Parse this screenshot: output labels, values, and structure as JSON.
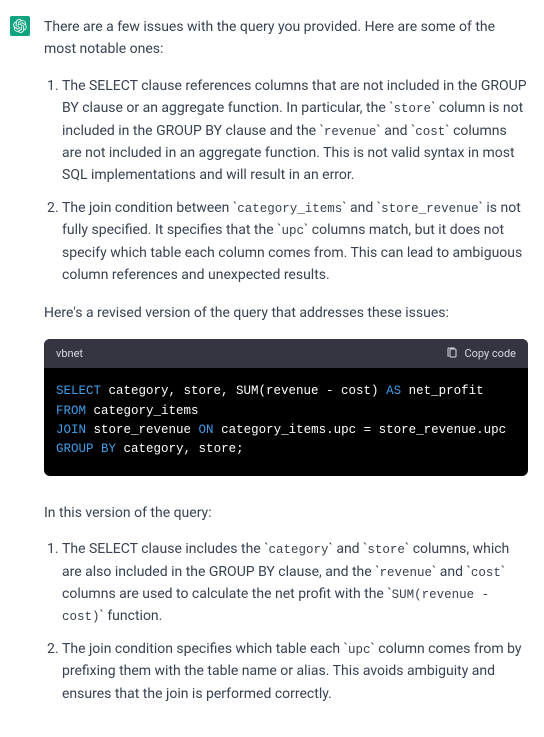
{
  "intro": "There are a few issues with the query you provided. Here are some of the most notable ones:",
  "issues": [
    {
      "seg1": "The SELECT clause references columns that are not included in the GROUP BY clause or an aggregate function. In particular, the ",
      "c1": "store",
      "seg2": " column is not included in the GROUP BY clause and the ",
      "c2": "revenue",
      "seg3": " and ",
      "c3": "cost",
      "seg4": " columns are not included in an aggregate function. This is not valid syntax in most SQL implementations and will result in an error."
    },
    {
      "seg1": "The join condition between ",
      "c1": "category_items",
      "seg2": " and ",
      "c2": "store_revenue",
      "seg3": " is not fully specified. It specifies that the ",
      "c3": "upc",
      "seg4": " columns match, but it does not specify which table each column comes from. This can lead to ambiguous column references and unexpected results."
    }
  ],
  "revised_intro": "Here's a revised version of the query that addresses these issues:",
  "code": {
    "lang": "vbnet",
    "copy_label": "Copy code",
    "l1": {
      "kw": "SELECT",
      "rest1": " category, store, SUM(revenue - cost) ",
      "as": "AS",
      "rest2": " net_profit"
    },
    "l2": {
      "kw": "FROM",
      "rest": " category_items"
    },
    "l3": {
      "kw": "JOIN",
      "rest1": " store_revenue ",
      "on": "ON",
      "rest2": " category_items.upc = store_revenue.upc"
    },
    "l4": {
      "kw1": "GROUP",
      "sp": " ",
      "kw2": "BY",
      "rest": " category, store;"
    }
  },
  "explain_intro": "In this version of the query:",
  "explains": [
    {
      "seg1": "The SELECT clause includes the ",
      "c1": "category",
      "seg2": " and ",
      "c2": "store",
      "seg3": " columns, which are also included in the GROUP BY clause, and the ",
      "c3": "revenue",
      "seg4": " and ",
      "c4": "cost",
      "seg5": " columns are used to calculate the net profit with the ",
      "c5": "SUM(revenue - cost)",
      "seg6": " function."
    },
    {
      "seg1": "The join condition specifies which table each ",
      "c1": "upc",
      "seg2": " column comes from by prefixing them with the table name or alias. This avoids ambiguity and ensures that the join is performed correctly."
    }
  ]
}
